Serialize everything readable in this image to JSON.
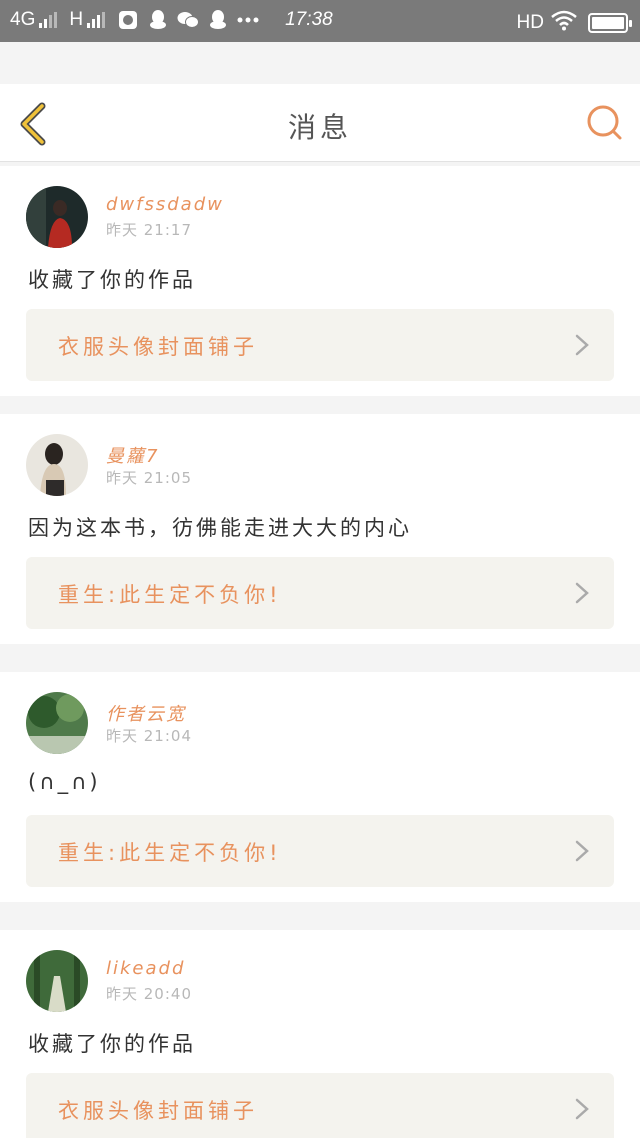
{
  "status_bar": {
    "network_1": "4G",
    "network_2": "H",
    "time": "17:38",
    "hd": "HD"
  },
  "header": {
    "title": "消息",
    "back_icon": "chevron-left-icon",
    "search_icon": "search-icon"
  },
  "colors": {
    "accent": "#e8925e",
    "back_icon": "#f0c23a",
    "card_bg": "#f4f3ee"
  },
  "messages": [
    {
      "username": "dwfssdadw",
      "time": "昨天 21:17",
      "content": "收藏了你的作品",
      "work_title": "衣服头像封面铺子"
    },
    {
      "username": "曼蘿7",
      "time": "昨天 21:05",
      "content": "因为这本书，彷佛能走进大大的内心",
      "work_title": "重生:此生定不负你!"
    },
    {
      "username": "作者云宽",
      "time": "昨天 21:04",
      "content": "(∩_∩)",
      "work_title": "重生:此生定不负你!"
    },
    {
      "username": "likeadd",
      "time": "昨天 20:40",
      "content": "收藏了你的作品",
      "work_title": "衣服头像封面铺子"
    }
  ]
}
